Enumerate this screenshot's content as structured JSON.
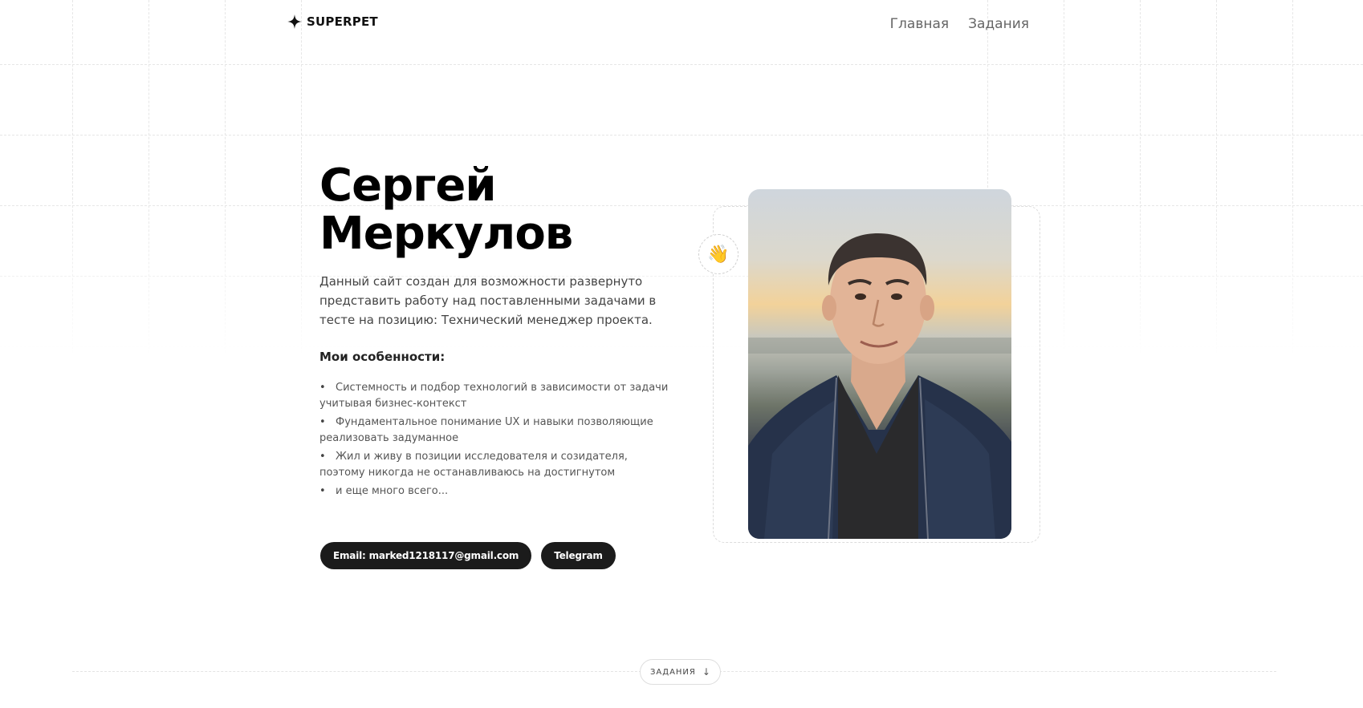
{
  "header": {
    "logo_text": "SUPERPET",
    "logo_icon": "four-point-star-icon",
    "nav": [
      {
        "label": "Главная"
      },
      {
        "label": "Задания"
      }
    ]
  },
  "hero": {
    "title_line1": "Сергей",
    "title_line2": "Меркулов",
    "description": "Данный сайт создан для возможности развернуто представить работу над поставленными задачами в тесте на позицию: Технический менеджер проекта.",
    "features_title": "Мои особенности:",
    "features": [
      "Системность и подбор технологий в зависимости от задачи учитывая бизнес-контекст",
      "Фундаментальное понимание UX и навыки позволяющие реализовать задуманное",
      "Жил и живу в позиции исследователя и созидателя, поэтому никогда не останавливаюсь на достигнутом",
      "и еще много всего..."
    ],
    "buttons": {
      "email": "Email: marked1218117@gmail.com",
      "telegram": "Telegram"
    },
    "wave_emoji": "👋"
  },
  "section_tag": {
    "label": "ЗАДАНИЯ",
    "arrow": "↓"
  },
  "colors": {
    "button_bg": "#1b1b1b",
    "text_primary": "#000000",
    "text_secondary": "#444444"
  }
}
